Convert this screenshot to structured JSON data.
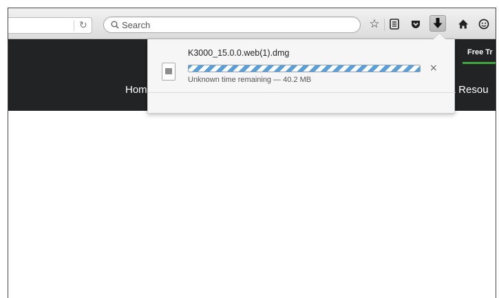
{
  "toolbar": {
    "reload_icon": "↻",
    "search": {
      "placeholder": "Search",
      "value": ""
    },
    "icons": [
      {
        "name": "star",
        "glyph": "☆"
      },
      {
        "name": "reading-list",
        "glyph": "☰"
      },
      {
        "name": "pocket",
        "glyph": "⛉"
      },
      {
        "name": "download",
        "glyph": "⬇"
      },
      {
        "name": "home",
        "glyph": "⌂"
      },
      {
        "name": "chat",
        "glyph": "☺"
      }
    ]
  },
  "page": {
    "nav_top_right": "Free Tr",
    "nav_home": "Hom",
    "nav_resources": "& Resou"
  },
  "download_panel": {
    "file_name": "K3000_15.0.0.web(1).dmg",
    "status": "Unknown time remaining — 40.2 MB",
    "progress_percent": 100,
    "close_glyph": "×"
  },
  "colors": {
    "page_background": "#222325",
    "progress_stripe": "#5b9fd8",
    "nav_underline": "#3fa83f"
  }
}
